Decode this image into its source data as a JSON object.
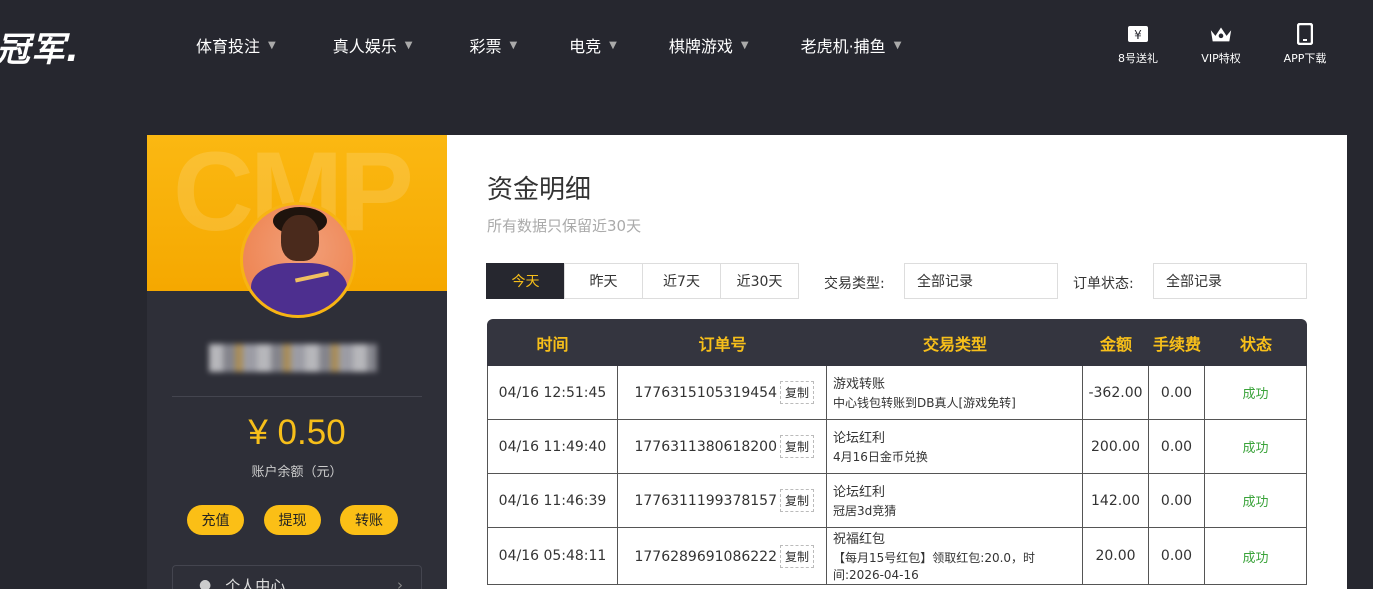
{
  "header": {
    "logo": "冠军.",
    "nav": [
      {
        "label": "体育投注"
      },
      {
        "label": "真人娱乐"
      },
      {
        "label": "彩票"
      },
      {
        "label": "电竞"
      },
      {
        "label": "棋牌游戏"
      },
      {
        "label": "老虎机·捕鱼"
      }
    ],
    "quick": [
      {
        "label": "8号送礼",
        "icon": "gift-ticket-icon"
      },
      {
        "label": "VIP特权",
        "icon": "crown-icon"
      },
      {
        "label": "APP下载",
        "icon": "phone-icon"
      }
    ]
  },
  "profile": {
    "watermark": "CMP",
    "balance": "¥ 0.50",
    "balance_label": "账户余额（元）",
    "buttons": {
      "deposit": "充值",
      "withdraw": "提现",
      "transfer": "转账"
    },
    "menu_item": "个人中心"
  },
  "main": {
    "title": "资金明细",
    "subtitle": "所有数据只保留近30天",
    "tabs": [
      {
        "label": "今天",
        "active": true
      },
      {
        "label": "昨天"
      },
      {
        "label": "近7天"
      },
      {
        "label": "近30天"
      }
    ],
    "filters": {
      "type_label": "交易类型:",
      "type_value": "全部记录",
      "status_label": "订单状态:",
      "status_value": "全部记录"
    },
    "table": {
      "headers": [
        "时间",
        "订单号",
        "交易类型",
        "金额",
        "手续费",
        "状态"
      ],
      "copy_label": "复制",
      "rows": [
        {
          "time": "04/16 12:51:45",
          "order": "1776315105319454",
          "type": "游戏转账",
          "desc": "中心钱包转账到DB真人[游戏免转]",
          "amount": "-362.00",
          "fee": "0.00",
          "status": "成功"
        },
        {
          "time": "04/16 11:49:40",
          "order": "1776311380618200",
          "type": "论坛红利",
          "desc": "4月16日金币兑换",
          "amount": "200.00",
          "fee": "0.00",
          "status": "成功"
        },
        {
          "time": "04/16 11:46:39",
          "order": "1776311199378157",
          "type": "论坛红利",
          "desc": "冠居3d竞猜",
          "amount": "142.00",
          "fee": "0.00",
          "status": "成功"
        },
        {
          "time": "04/16 05:48:11",
          "order": "1776289691086222",
          "type": "祝福红包",
          "desc": "【每月15号红包】领取红包:20.0，时间:2026-04-16",
          "amount": "20.00",
          "fee": "0.00",
          "status": "成功"
        }
      ]
    }
  },
  "colors": {
    "accent": "#f7bf1a",
    "dark": "#26272f",
    "success": "#3aa33a"
  }
}
